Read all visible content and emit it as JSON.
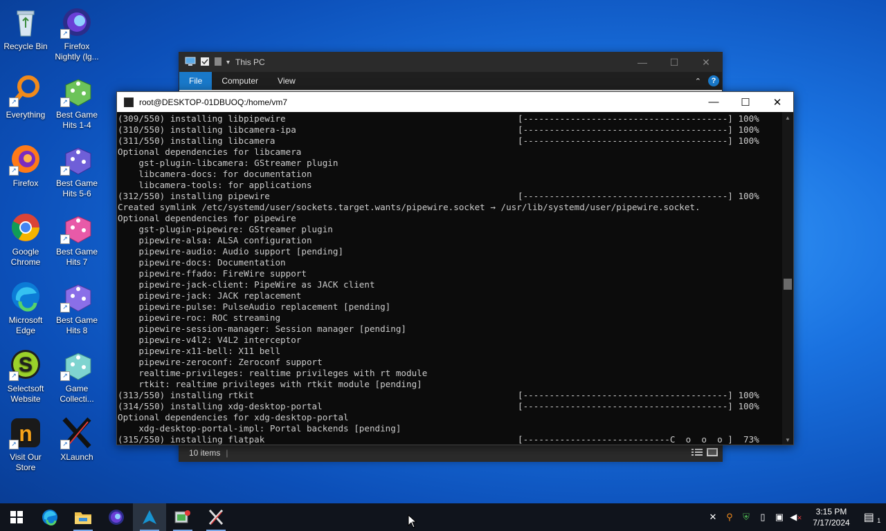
{
  "desktop": {
    "icons": [
      {
        "label": "Recycle Bin",
        "icon": "recycle-bin-icon"
      },
      {
        "label": "Firefox Nightly (lg...",
        "icon": "firefox-nightly-icon"
      },
      {
        "label": "Everything",
        "icon": "everything-search-icon"
      },
      {
        "label": "Best Game Hits 1-4",
        "icon": "game-dice-icon"
      },
      {
        "label": "Firefox",
        "icon": "firefox-icon"
      },
      {
        "label": "Best Game Hits 5-6",
        "icon": "game-dice-icon"
      },
      {
        "label": "Google Chrome",
        "icon": "chrome-icon"
      },
      {
        "label": "Best Game Hits 7",
        "icon": "game-dice-icon"
      },
      {
        "label": "Microsoft Edge",
        "icon": "edge-icon"
      },
      {
        "label": "Best Game Hits 8",
        "icon": "game-dice-icon"
      },
      {
        "label": "Selectsoft Website",
        "icon": "selectsoft-icon"
      },
      {
        "label": "Game Collecti...",
        "icon": "game-dice-icon"
      },
      {
        "label": "Visit Our Store",
        "icon": "store-icon"
      },
      {
        "label": "XLaunch",
        "icon": "xlaunch-icon"
      }
    ]
  },
  "explorer": {
    "title": "This PC",
    "tabs": [
      "File",
      "Computer",
      "View"
    ],
    "status": "10 items",
    "controls": {
      "minimize": "—",
      "maximize": "☐",
      "close": "✕"
    },
    "help": "?"
  },
  "terminal": {
    "title": "root@DESKTOP-01DBUOQ:/home/vm7",
    "controls": {
      "minimize": "—",
      "maximize": "☐",
      "close": "✕"
    },
    "lines": [
      {
        "text": "(309/550) installing libpipewire",
        "right": "[---------------------------------------] 100%"
      },
      {
        "text": "(310/550) installing libcamera-ipa",
        "right": "[---------------------------------------] 100%"
      },
      {
        "text": "(311/550) installing libcamera",
        "right": "[---------------------------------------] 100%"
      },
      {
        "text": "Optional dependencies for libcamera",
        "right": ""
      },
      {
        "text": "    gst-plugin-libcamera: GStreamer plugin",
        "right": ""
      },
      {
        "text": "    libcamera-docs: for documentation",
        "right": ""
      },
      {
        "text": "    libcamera-tools: for applications",
        "right": ""
      },
      {
        "text": "(312/550) installing pipewire",
        "right": "[---------------------------------------] 100%"
      },
      {
        "text": "Created symlink /etc/systemd/user/sockets.target.wants/pipewire.socket → /usr/lib/systemd/user/pipewire.socket.",
        "right": ""
      },
      {
        "text": "Optional dependencies for pipewire",
        "right": ""
      },
      {
        "text": "    gst-plugin-pipewire: GStreamer plugin",
        "right": ""
      },
      {
        "text": "    pipewire-alsa: ALSA configuration",
        "right": ""
      },
      {
        "text": "    pipewire-audio: Audio support [pending]",
        "right": ""
      },
      {
        "text": "    pipewire-docs: Documentation",
        "right": ""
      },
      {
        "text": "    pipewire-ffado: FireWire support",
        "right": ""
      },
      {
        "text": "    pipewire-jack-client: PipeWire as JACK client",
        "right": ""
      },
      {
        "text": "    pipewire-jack: JACK replacement",
        "right": ""
      },
      {
        "text": "    pipewire-pulse: PulseAudio replacement [pending]",
        "right": ""
      },
      {
        "text": "    pipewire-roc: ROC streaming",
        "right": ""
      },
      {
        "text": "    pipewire-session-manager: Session manager [pending]",
        "right": ""
      },
      {
        "text": "    pipewire-v4l2: V4L2 interceptor",
        "right": ""
      },
      {
        "text": "    pipewire-x11-bell: X11 bell",
        "right": ""
      },
      {
        "text": "    pipewire-zeroconf: Zeroconf support",
        "right": ""
      },
      {
        "text": "    realtime-privileges: realtime privileges with rt module",
        "right": ""
      },
      {
        "text": "    rtkit: realtime privileges with rtkit module [pending]",
        "right": ""
      },
      {
        "text": "(313/550) installing rtkit",
        "right": "[---------------------------------------] 100%"
      },
      {
        "text": "(314/550) installing xdg-desktop-portal",
        "right": "[---------------------------------------] 100%"
      },
      {
        "text": "Optional dependencies for xdg-desktop-portal",
        "right": ""
      },
      {
        "text": "    xdg-desktop-portal-impl: Portal backends [pending]",
        "right": ""
      },
      {
        "text": "(315/550) installing flatpak",
        "right": "[----------------------------C  o  o  o ]  73%"
      }
    ]
  },
  "taskbar": {
    "apps": [
      {
        "name": "start-button",
        "icon": "windows-start-icon"
      },
      {
        "name": "edge",
        "icon": "edge-icon"
      },
      {
        "name": "file-explorer",
        "icon": "folder-icon"
      },
      {
        "name": "firefox-nightly",
        "icon": "firefox-nightly-icon"
      },
      {
        "name": "terminal",
        "icon": "arch-terminal-icon"
      },
      {
        "name": "task-app",
        "icon": "app-icon"
      },
      {
        "name": "xlaunch",
        "icon": "xlaunch-icon"
      }
    ],
    "time": "3:15 PM",
    "date": "7/17/2024",
    "notification_count": "1"
  }
}
